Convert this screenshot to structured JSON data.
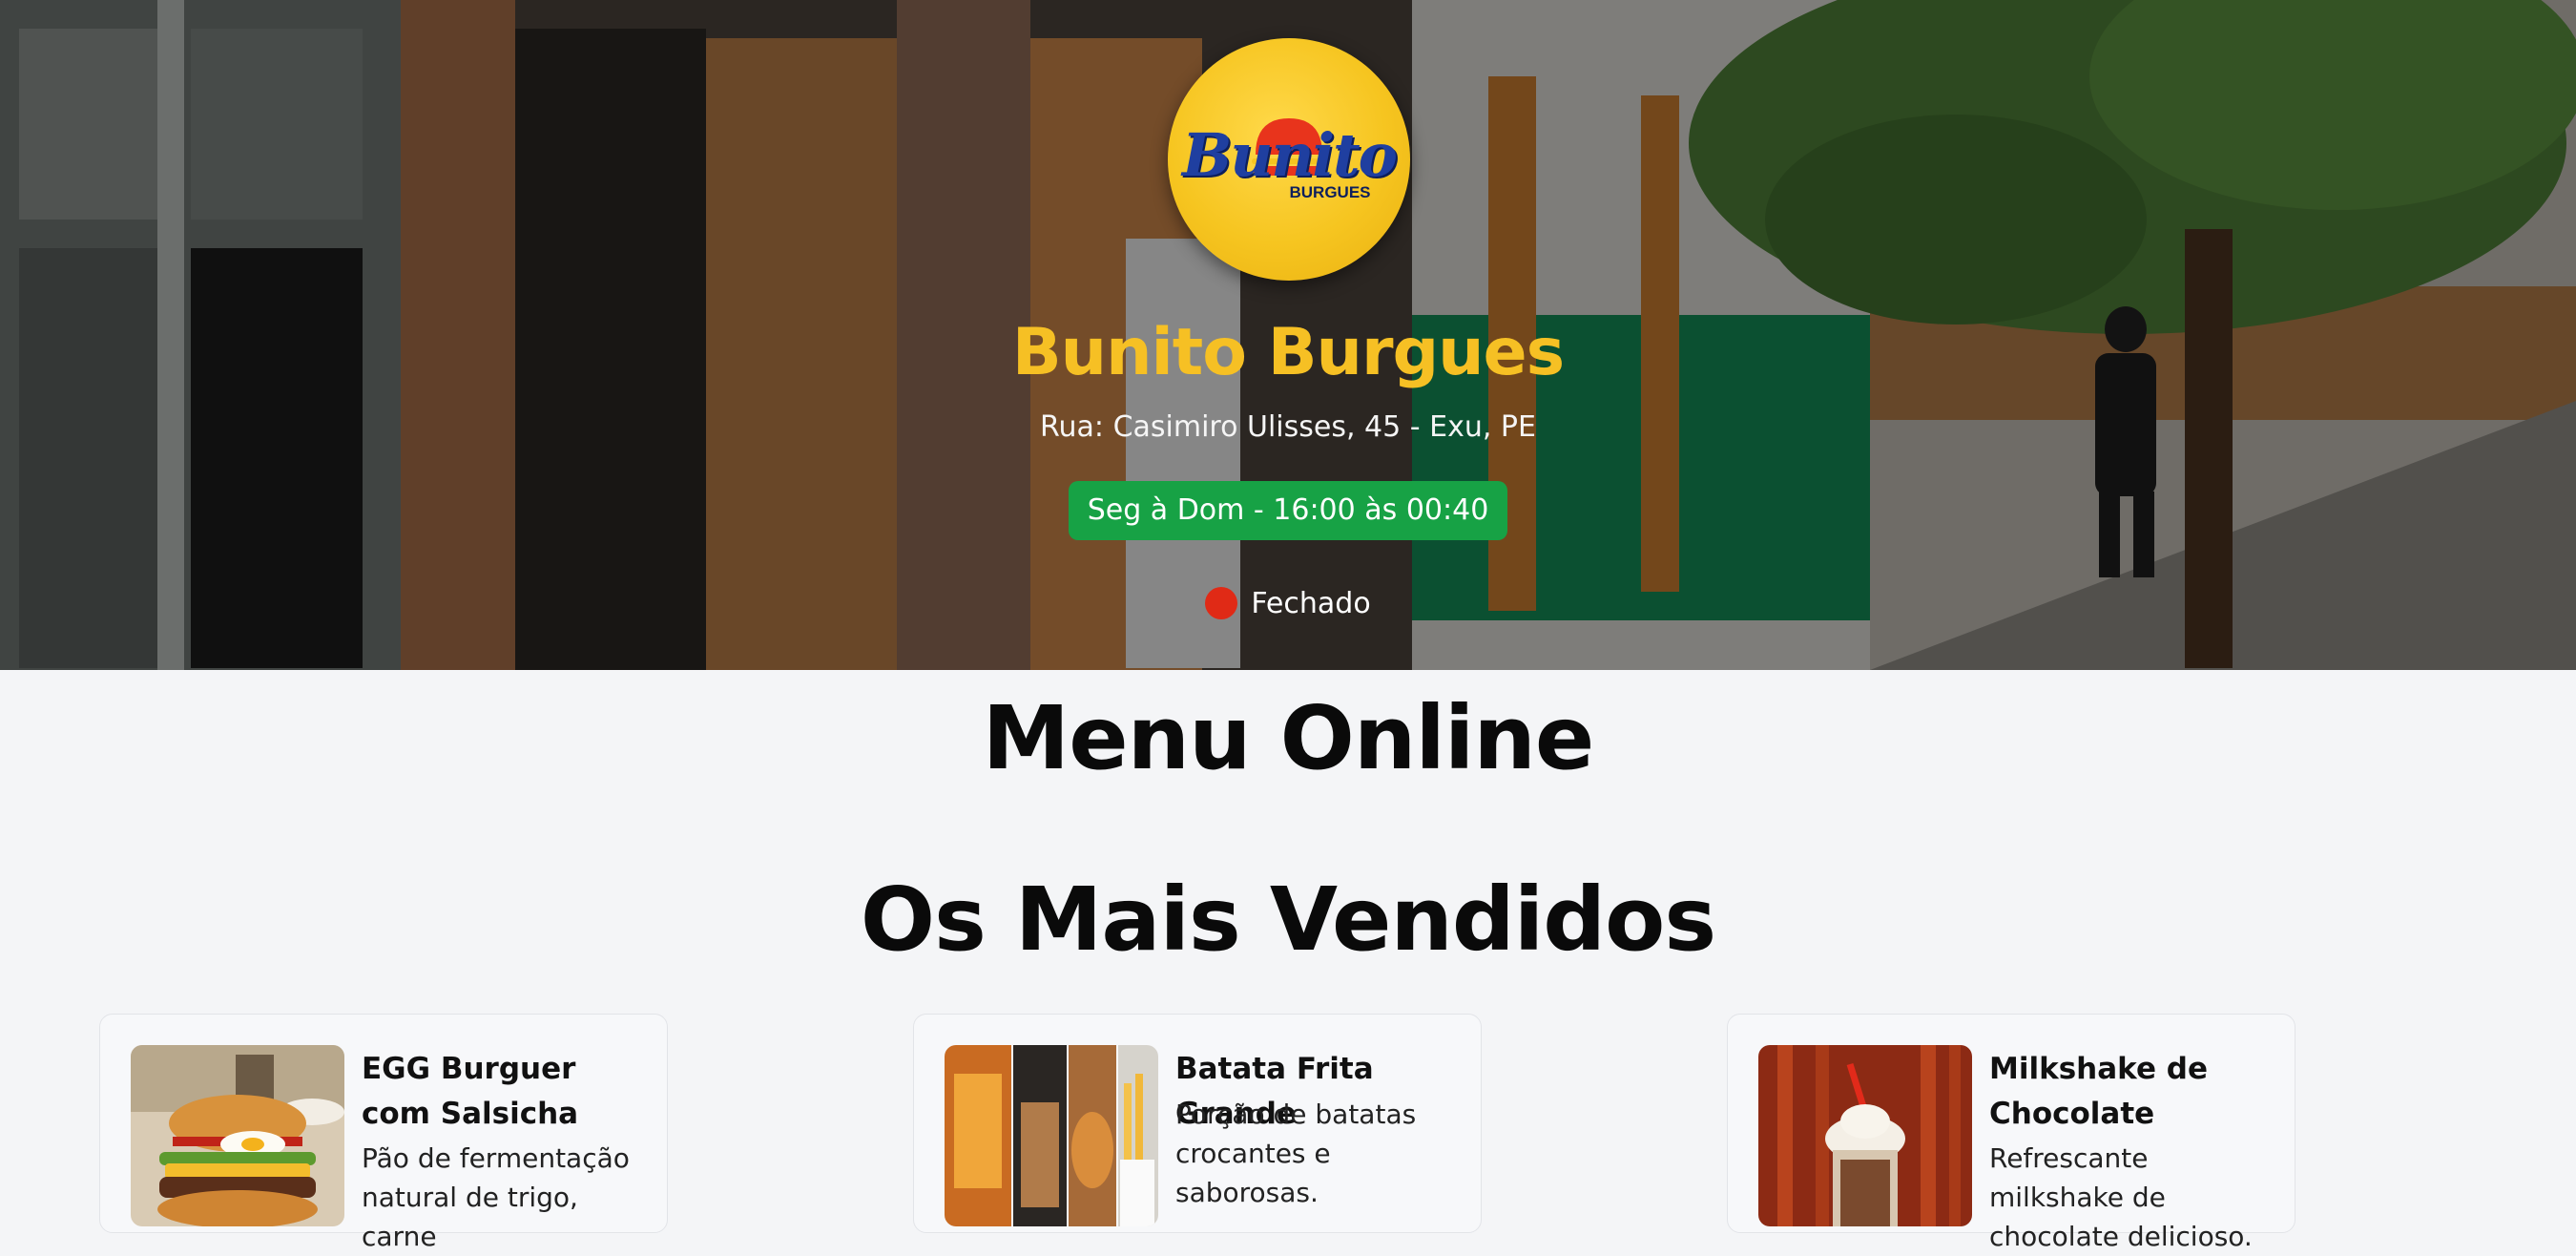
{
  "store": {
    "logo_text": "Bunito",
    "logo_subtext": "BURGUES",
    "name": "Bunito Burgues",
    "address": "Rua: Casimiro Ulisses, 45 - Exu, PE",
    "hours": "Seg à Dom - 16:00 às 00:40",
    "status": "Fechado",
    "status_color": "#e02a16",
    "hours_badge_color": "#17a245",
    "name_color": "#f6c024"
  },
  "menu": {
    "title": "Menu Online",
    "section_title": "Os Mais Vendidos",
    "products": [
      {
        "name": "EGG Burguer com Salsicha",
        "description": "Pão de fermentação natural de trigo, carne",
        "image_icon": "burger-photo"
      },
      {
        "name": "Batata Frita Grande",
        "description": "Porção de batatas crocantes e saborosas.",
        "image_icon": "fries-photo"
      },
      {
        "name": "Milkshake de Chocolate",
        "description": "Refrescante milkshake de chocolate delicioso.",
        "image_icon": "milkshake-photo"
      }
    ]
  }
}
